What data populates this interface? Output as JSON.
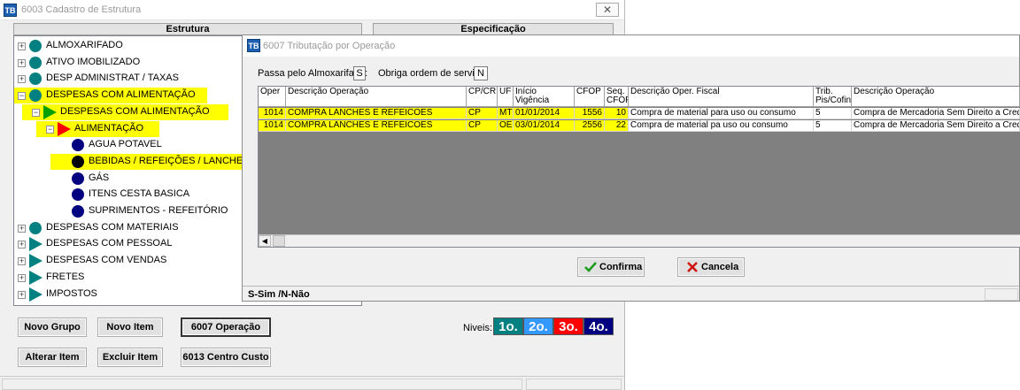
{
  "main_window": {
    "title": "6003 Cadastro de Estrutura",
    "close_glyph": "✕",
    "headers": {
      "estrutura": "Estrutura",
      "especificacao": "Especificação"
    },
    "tree": [
      {
        "label": "ALMOXARIFADO",
        "expander": "+",
        "icon": "circle",
        "color": "#008080",
        "highlighted": false
      },
      {
        "label": "ATIVO IMOBILIZADO",
        "expander": "+",
        "icon": "circle",
        "color": "#008080",
        "highlighted": false
      },
      {
        "label": "DESP ADMINISTRAT / TAXAS",
        "expander": "+",
        "icon": "circle",
        "color": "#008080",
        "highlighted": false
      },
      {
        "label": "DESPESAS COM ALIMENTAÇÃO",
        "expander": "−",
        "icon": "circle",
        "color": "#008080",
        "highlighted": true
      },
      {
        "label": "DESPESAS COM ALIMENTAÇÃO",
        "expander": "−",
        "icon": "triangle",
        "color": "#00a000",
        "highlighted": true
      },
      {
        "label": "ALIMENTAÇÃO",
        "expander": "−",
        "icon": "triangle",
        "color": "#ff0000",
        "highlighted": true
      },
      {
        "label": "AGUA POTAVEL",
        "expander": "",
        "icon": "circle",
        "color": "#000080",
        "highlighted": false
      },
      {
        "label": "BEBIDAS / REFEIÇÕES / LANCHES",
        "expander": "",
        "icon": "circle",
        "color": "#000000",
        "highlighted": true
      },
      {
        "label": "GÁS",
        "expander": "",
        "icon": "circle",
        "color": "#000080",
        "highlighted": false
      },
      {
        "label": "ITENS CESTA BASICA",
        "expander": "",
        "icon": "circle",
        "color": "#000080",
        "highlighted": false
      },
      {
        "label": "SUPRIMENTOS - REFEITÓRIO",
        "expander": "",
        "icon": "circle",
        "color": "#000080",
        "highlighted": false
      },
      {
        "label": "DESPESAS COM MATERIAIS",
        "expander": "+",
        "icon": "circle",
        "color": "#008080",
        "highlighted": false
      },
      {
        "label": "DESPESAS COM PESSOAL",
        "expander": "+",
        "icon": "triangle",
        "color": "#008080",
        "highlighted": false
      },
      {
        "label": "DESPESAS COM VENDAS",
        "expander": "+",
        "icon": "triangle",
        "color": "#008080",
        "highlighted": false
      },
      {
        "label": "FRETES",
        "expander": "+",
        "icon": "triangle",
        "color": "#008080",
        "highlighted": false
      },
      {
        "label": "IMPOSTOS",
        "expander": "+",
        "icon": "triangle",
        "color": "#008080",
        "highlighted": false
      }
    ],
    "buttons": {
      "novo_grupo": "Novo Grupo",
      "novo_item": "Novo Item",
      "operacao": "6007 Operação",
      "alterar_item": "Alterar Item",
      "excluir_item": "Excluir Item",
      "centro_custo": "6013 Centro Custo"
    },
    "niveis_label": "Niveis:",
    "niveis": [
      {
        "label": "1o.",
        "color": "#008080"
      },
      {
        "label": "2o.",
        "color": "#3399ff"
      },
      {
        "label": "3o.",
        "color": "#ff0000"
      },
      {
        "label": "4o.",
        "color": "#000080"
      }
    ]
  },
  "dialog": {
    "title": "6007 Tributação por Operação",
    "passa_label": "Passa pelo Almoxarifado:",
    "passa_value": "S",
    "obriga_label": "Obriga ordem de serviço:",
    "obriga_value": "N",
    "columns": [
      "Oper",
      "Descrição Operação",
      "CP/CR",
      "UF",
      "Início Vigência",
      "CFOP",
      "Seq. CFOP",
      "Descrição Oper. Fiscal",
      "Trib. Pis/Cofins",
      "Descrição Operação"
    ],
    "rows": [
      [
        "1014",
        "COMPRA LANCHES E REFEICOES",
        "CP",
        "MT",
        "01/01/2014",
        "1556",
        "10",
        "Compra de material para uso ou consumo",
        "5",
        "Compra de Mercadoria Sem Direito a Cred"
      ],
      [
        "1014",
        "COMPRA LANCHES E REFEICOES",
        "CP",
        "OE",
        "03/01/2014",
        "2556",
        "22",
        "Compra de material pa uso ou consumo",
        "5",
        "Compra de Mercadoria Sem Direito a Cred"
      ]
    ],
    "confirma_label": "Confirma",
    "cancela_label": "Cancela",
    "status_text": "S-Sim /N-Não"
  }
}
